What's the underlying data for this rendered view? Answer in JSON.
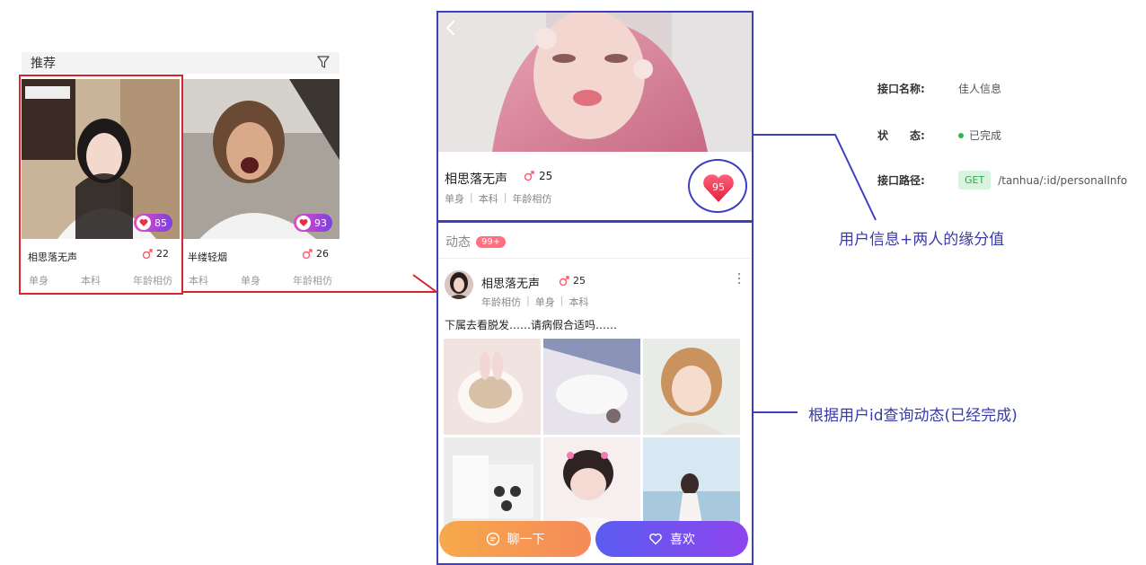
{
  "recommend": {
    "title": "推荐",
    "filter_icon": "filter-icon",
    "cards": [
      {
        "name": "相思落无声",
        "age": "22",
        "fate": "85",
        "tags": [
          "单身",
          "本科",
          "年龄相仿"
        ]
      },
      {
        "name": "半缕轻烟",
        "age": "26",
        "fate": "93",
        "tags": [
          "本科",
          "单身",
          "年龄相仿"
        ]
      }
    ]
  },
  "profile": {
    "back_icon": "back-arrow-icon",
    "name": "相思落无声",
    "age": "25",
    "tags": [
      "单身",
      "本科",
      "年龄相仿"
    ],
    "fate": "95"
  },
  "feed": {
    "title": "动态",
    "count": "99+",
    "post": {
      "name": "相思落无声",
      "age": "25",
      "tags": [
        "年龄相仿",
        "单身",
        "本科"
      ],
      "text": "下属去看脱发……请病假合适吗……"
    }
  },
  "actions": {
    "chat_label": "聊一下",
    "like_label": "喜欢"
  },
  "api": {
    "name_label": "接口名称:",
    "name_value": "佳人信息",
    "status_label": "状　　态:",
    "status_value": "已完成",
    "path_label": "接口路径:",
    "method": "GET",
    "path_value": "/tanhua/:id/personalInfo"
  },
  "notes": {
    "user_info": "用户信息+两人的缘分值",
    "feed_query": "根据用户id查询动态(已经完成)"
  },
  "colors": {
    "annotation_blue": "#3e3ec0",
    "highlight_red": "#d9232d",
    "status_green": "#2fb84a",
    "chat_gradient": [
      "#f7a94a",
      "#f58a5a"
    ],
    "like_gradient": [
      "#5a5cf0",
      "#8e45ee"
    ]
  }
}
